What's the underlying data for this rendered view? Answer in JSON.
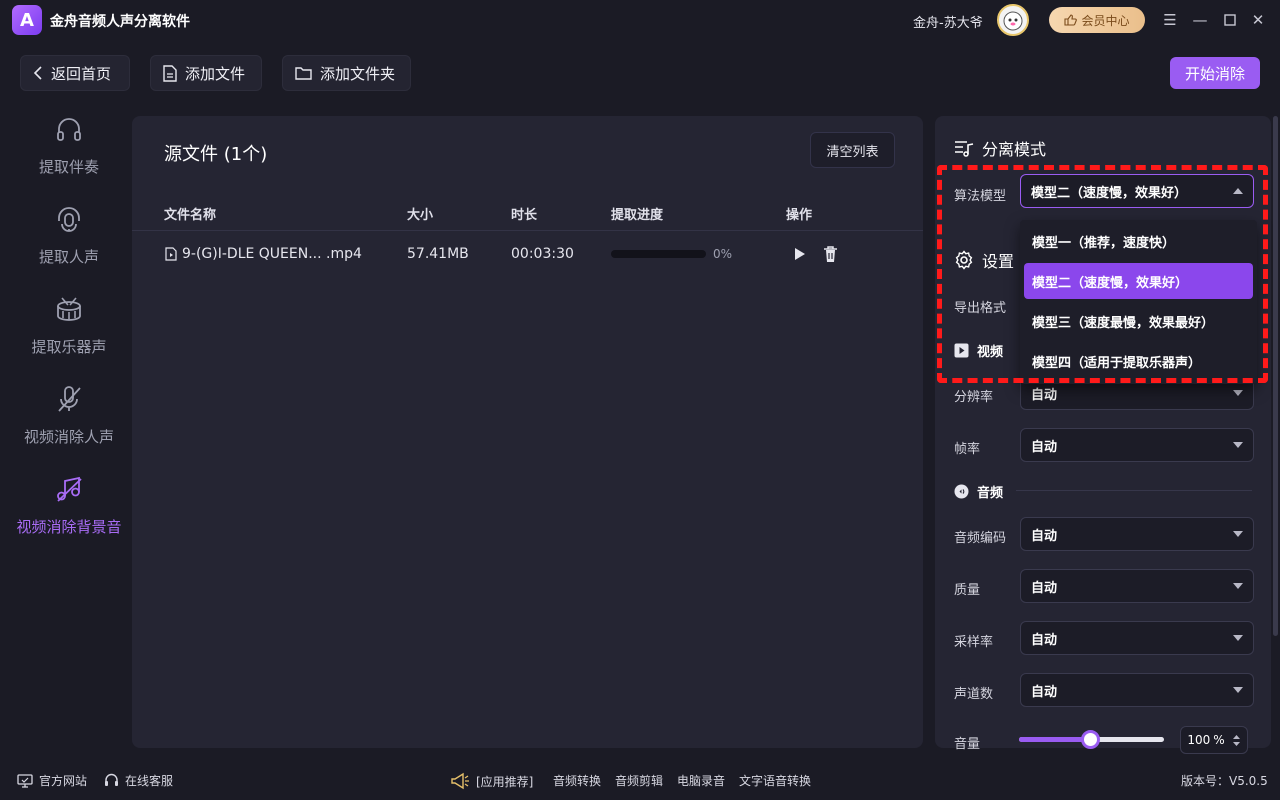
{
  "titlebar": {
    "app_title": "金舟音频人声分离软件",
    "logo_letter": "A",
    "username": "金舟-苏大爷",
    "vip_label": "会员中心"
  },
  "toolbar": {
    "back_label": "返回首页",
    "add_file_label": "添加文件",
    "add_folder_label": "添加文件夹",
    "start_label": "开始消除"
  },
  "sidebar": {
    "items": [
      {
        "label": "提取伴奏",
        "icon": "headphones-icon"
      },
      {
        "label": "提取人声",
        "icon": "headset-mic-icon"
      },
      {
        "label": "提取乐器声",
        "icon": "drum-icon"
      },
      {
        "label": "视频消除人声",
        "icon": "mic-off-icon"
      },
      {
        "label": "视频消除背景音",
        "icon": "music-off-icon"
      }
    ],
    "active_index": 4
  },
  "main": {
    "title": "源文件 (1个)",
    "clear_label": "清空列表",
    "columns": [
      "文件名称",
      "大小",
      "时长",
      "提取进度",
      "操作"
    ],
    "rows": [
      {
        "name": "9-(G)I-DLE QUEEN...  .mp4",
        "size": "57.41MB",
        "duration": "00:03:30",
        "progress_pct": "0%",
        "progress": 0
      }
    ]
  },
  "right": {
    "mode_title": "分离模式",
    "algo_label": "算法模型",
    "algo_value": "模型二（速度慢，效果好）",
    "algo_options": [
      "模型一（推荐，速度快）",
      "模型二（速度慢，效果好）",
      "模型三（速度最慢，效果最好）",
      "模型四（适用于提取乐器声）"
    ],
    "algo_selected_index": 1,
    "settings_title": "设置",
    "export_label": "导出格式",
    "video_title": "视频",
    "resolution_label": "分辨率",
    "resolution_value": "自动",
    "framerate_label": "帧率",
    "framerate_value": "自动",
    "audio_title": "音频",
    "codec_label": "音频编码",
    "codec_value": "自动",
    "quality_label": "质量",
    "quality_value": "自动",
    "samplerate_label": "采样率",
    "samplerate_value": "自动",
    "channels_label": "声道数",
    "channels_value": "自动",
    "volume_label": "音量",
    "volume_value": "100",
    "volume_unit": "%",
    "volume_level": 0.5
  },
  "footer": {
    "website_label": "官方网站",
    "service_label": "在线客服",
    "recommend_label": "[应用推荐]",
    "apps": [
      "音频转换",
      "音频剪辑",
      "电脑录音",
      "文字语音转换"
    ],
    "version": "版本号：V5.0.5"
  },
  "colors": {
    "accent": "#9a5cf2",
    "highlight_box": "#ff1a1a",
    "background": "#1b1b25",
    "panel": "#252533"
  }
}
